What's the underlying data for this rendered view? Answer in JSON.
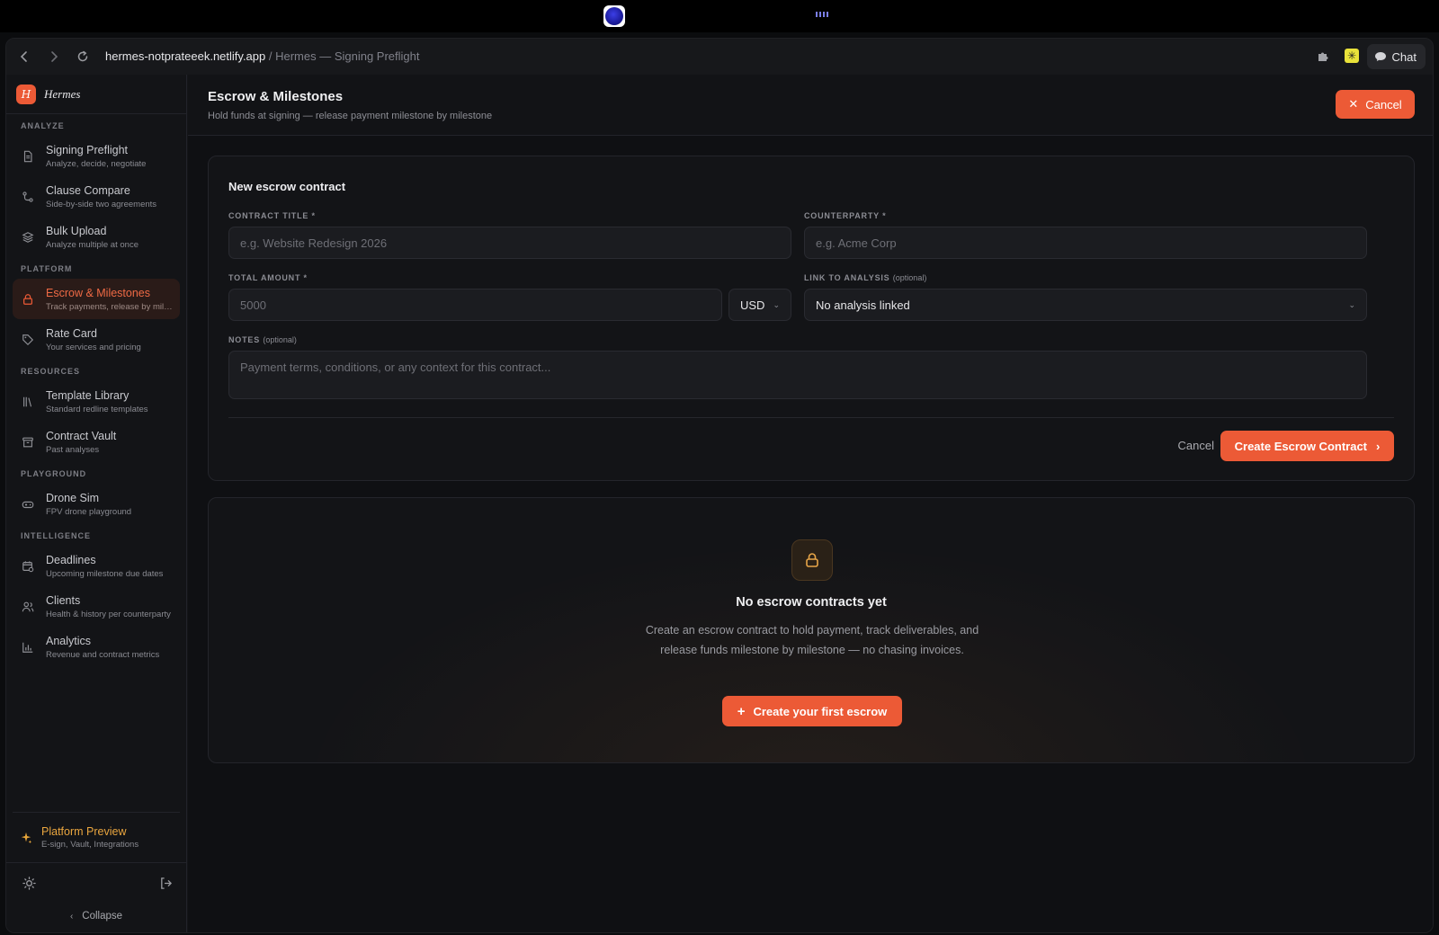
{
  "browser": {
    "url_host": "hermes-notprateeek.netlify.app",
    "url_path": " / Hermes — Signing Preflight",
    "chat_label": "Chat"
  },
  "sidebar": {
    "brand": "Hermes",
    "brand_letter": "H",
    "sections": [
      {
        "label": "ANALYZE",
        "items": [
          {
            "title": "Signing Preflight",
            "subtitle": "Analyze, decide, negotiate",
            "icon": "document-icon"
          },
          {
            "title": "Clause Compare",
            "subtitle": "Side-by-side two agreements",
            "icon": "compare-icon"
          },
          {
            "title": "Bulk Upload",
            "subtitle": "Analyze multiple at once",
            "icon": "layers-icon"
          }
        ]
      },
      {
        "label": "PLATFORM",
        "items": [
          {
            "title": "Escrow & Milestones",
            "subtitle": "Track payments, release by milestone",
            "icon": "lock-icon",
            "active": true
          },
          {
            "title": "Rate Card",
            "subtitle": "Your services and pricing",
            "icon": "tag-icon"
          }
        ]
      },
      {
        "label": "RESOURCES",
        "items": [
          {
            "title": "Template Library",
            "subtitle": "Standard redline templates",
            "icon": "library-icon"
          },
          {
            "title": "Contract Vault",
            "subtitle": "Past analyses",
            "icon": "archive-icon"
          }
        ]
      },
      {
        "label": "PLAYGROUND",
        "items": [
          {
            "title": "Drone Sim",
            "subtitle": "FPV drone playground",
            "icon": "gamepad-icon"
          }
        ]
      },
      {
        "label": "INTELLIGENCE",
        "items": [
          {
            "title": "Deadlines",
            "subtitle": "Upcoming milestone due dates",
            "icon": "calendar-clock-icon"
          },
          {
            "title": "Clients",
            "subtitle": "Health & history per counterparty",
            "icon": "users-icon"
          },
          {
            "title": "Analytics",
            "subtitle": "Revenue and contract metrics",
            "icon": "bar-chart-icon"
          }
        ]
      }
    ],
    "preview_title": "Platform Preview",
    "preview_subtitle": "E-sign, Vault, Integrations",
    "collapse_label": "Collapse"
  },
  "header": {
    "title": "Escrow & Milestones",
    "subtitle": "Hold funds at signing — release payment milestone by milestone",
    "cancel_label": "Cancel"
  },
  "form": {
    "title": "New escrow contract",
    "contract_title_label": "CONTRACT TITLE *",
    "contract_title_placeholder": "e.g. Website Redesign 2026",
    "counterparty_label": "COUNTERPARTY *",
    "counterparty_placeholder": "e.g. Acme Corp",
    "amount_label": "TOTAL AMOUNT *",
    "amount_placeholder": "5000",
    "currency": "USD",
    "analysis_label": "LINK TO ANALYSIS",
    "analysis_optional": "(optional)",
    "analysis_value": "No analysis linked",
    "notes_label": "NOTES",
    "notes_optional": "(optional)",
    "notes_placeholder": "Payment terms, conditions, or any context for this contract...",
    "cancel_label": "Cancel",
    "submit_label": "Create Escrow Contract"
  },
  "empty": {
    "title": "No escrow contracts yet",
    "description": "Create an escrow contract to hold payment, track deliverables, and release funds milestone by milestone — no chasing invoices.",
    "button_label": "Create your first escrow"
  },
  "colors": {
    "accent": "#ec5a36",
    "preview": "#eaa63f",
    "background": "#0f1013"
  }
}
